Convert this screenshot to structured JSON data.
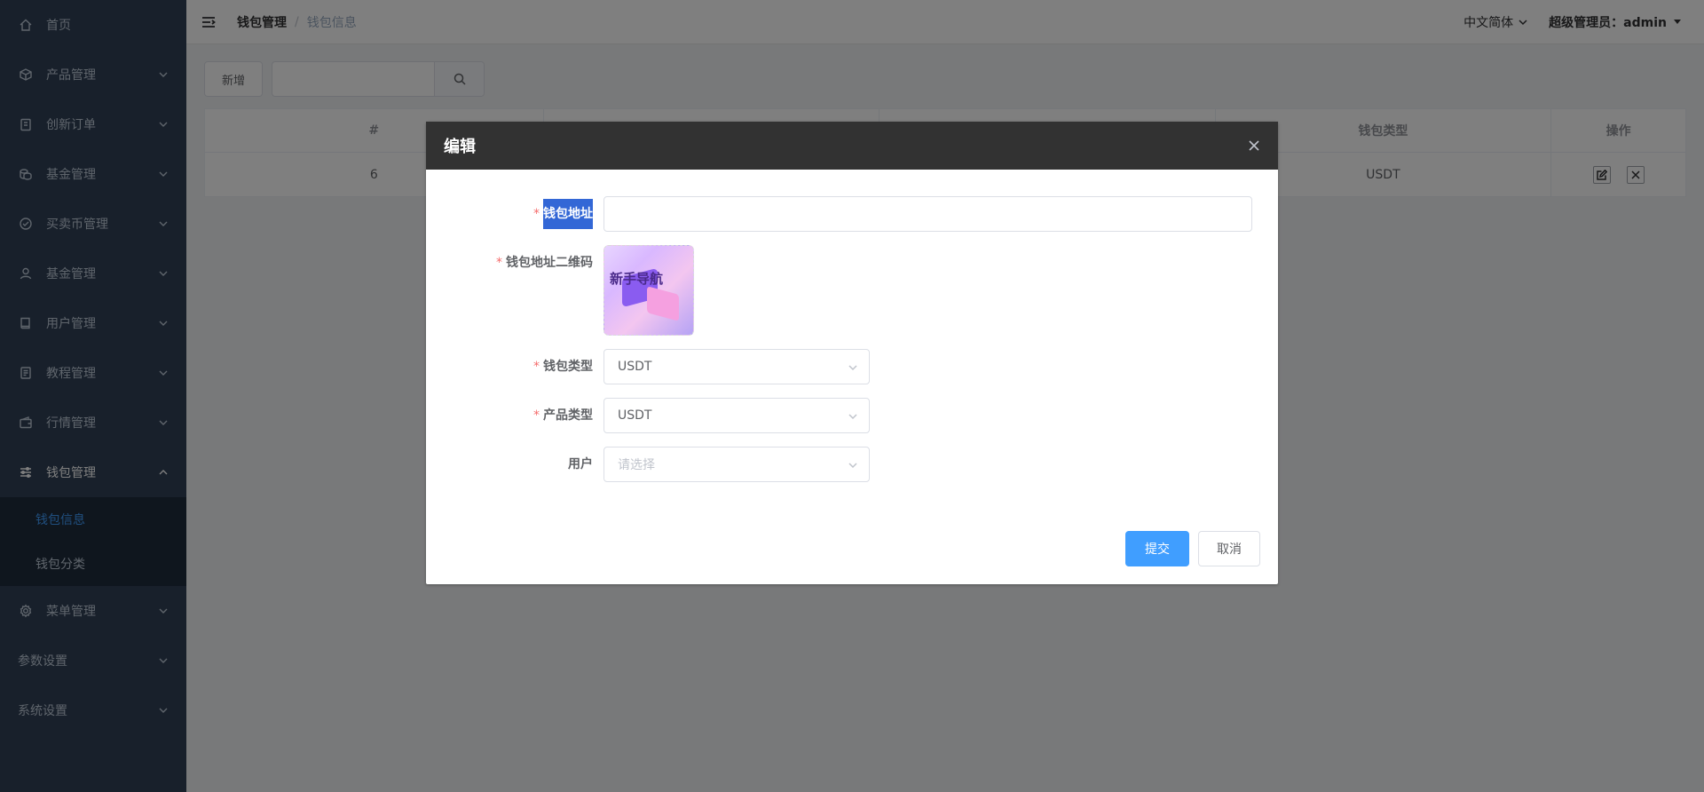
{
  "sidebar": {
    "items": [
      {
        "label": "首页",
        "icon": "home-icon"
      },
      {
        "label": "产品管理",
        "icon": "box-icon"
      },
      {
        "label": "创新订单",
        "icon": "clipboard-icon"
      },
      {
        "label": "基金管理",
        "icon": "coins-icon"
      },
      {
        "label": "买卖币管理",
        "icon": "check-circle-icon"
      },
      {
        "label": "基金管理",
        "icon": "user-icon"
      },
      {
        "label": "用户管理",
        "icon": "book-icon"
      },
      {
        "label": "教程管理",
        "icon": "document-icon"
      },
      {
        "label": "行情管理",
        "icon": "wallet-icon"
      },
      {
        "label": "钱包管理",
        "icon": "sliders-icon"
      }
    ],
    "sub_items": [
      {
        "label": "钱包信息"
      },
      {
        "label": "钱包分类"
      }
    ],
    "bottom_items": [
      {
        "label": "菜单管理",
        "icon": "gear-icon"
      },
      {
        "label": "参数设置"
      },
      {
        "label": "系统设置"
      }
    ]
  },
  "header": {
    "breadcrumb_parent": "钱包管理",
    "breadcrumb_separator": "/",
    "breadcrumb_current": "钱包信息",
    "language": "中文简体",
    "user": "超级管理员：admin"
  },
  "toolbar": {
    "add_label": "新增",
    "search_value": ""
  },
  "table": {
    "headers": [
      "#",
      "",
      "",
      "钱包类型",
      "操作"
    ],
    "rows": [
      {
        "id": "6",
        "col2": "",
        "col3": "",
        "type": "USDT"
      }
    ]
  },
  "dialog": {
    "title": "编辑",
    "fields": {
      "address_label": "钱包地址",
      "address_value": "",
      "qr_label": "钱包地址二维码",
      "qr_image_text": "新手导航",
      "wallet_type_label": "钱包类型",
      "wallet_type_value": "USDT",
      "product_type_label": "产品类型",
      "product_type_value": "USDT",
      "user_label": "用户",
      "user_placeholder": "请选择"
    },
    "required_mark": "*",
    "submit_label": "提交",
    "cancel_label": "取消"
  }
}
